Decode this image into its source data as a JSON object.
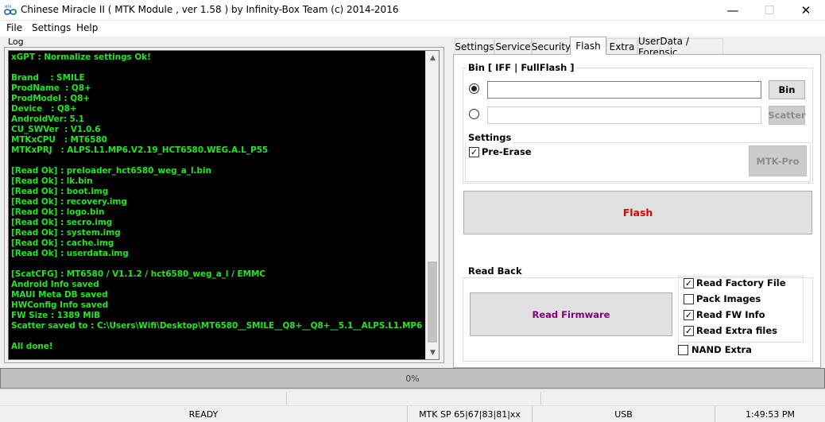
{
  "window": {
    "title": "Chinese Miracle II ( MTK Module , ver 1.58 ) by Infinity-Box Team (c) 2014-2016",
    "minimize_glyph": "—",
    "maximize_glyph": "☐",
    "close_glyph": "✕"
  },
  "menu": [
    "File",
    "Settings",
    "Help"
  ],
  "log": {
    "label": "Log",
    "lines": [
      "xGPT : Normalize settings Ok!",
      "",
      "Brand    : SMILE",
      "ProdName  : Q8+",
      "ProdModel : Q8+",
      "Device   : Q8+",
      "AndroidVer: 5.1",
      "CU_SWVer  : V1.0.6",
      "MTKxCPU   : MT6580",
      "MTKxPRJ   : ALPS.L1.MP6.V2.19_HCT6580.WEG.A.L_P55",
      "",
      "[Read Ok] : preloader_hct6580_weg_a_l.bin",
      "[Read Ok] : lk.bin",
      "[Read Ok] : boot.img",
      "[Read Ok] : recovery.img",
      "[Read Ok] : logo.bin",
      "[Read Ok] : secro.img",
      "[Read Ok] : system.img",
      "[Read Ok] : cache.img",
      "[Read Ok] : userdata.img",
      "",
      "[ScatCFG] : MT6580 / V1.1.2 / hct6580_weg_a_l / EMMC",
      "Android Info saved",
      "MAUI Meta DB saved",
      "HWConfig Info saved",
      "FW Size : 1389 MiB",
      "Scatter saved to : C:\\Users\\Wifi\\Desktop\\MT6580__SMILE__Q8+__Q8+__5.1__ALPS.L1.MP6",
      "",
      "All done!"
    ],
    "text_color": "#24e524"
  },
  "tabs": {
    "items": [
      "Settings",
      "Service",
      "Security",
      "Flash",
      "Extra",
      "UserData / Forensic"
    ],
    "active": "Flash"
  },
  "flash": {
    "bin_group_title": "Bin  [ IFF | FullFlash ]",
    "bin_path": "",
    "scatter_path": "",
    "bin_button": "Bin",
    "scatter_button": "Scatter",
    "settings_title": "Settings",
    "pre_erase_label": "Pre-Erase",
    "pre_erase_checked": true,
    "mtk_pro_button": "MTK-Pro",
    "flash_button": "Flash",
    "flash_button_color": "#e00000",
    "read_back_title": "Read Back",
    "read_firmware_button": "Read Firmware",
    "read_firmware_color": "#800080",
    "options": [
      {
        "label": "Read Factory File",
        "checked": true
      },
      {
        "label": "Pack Images",
        "checked": false
      },
      {
        "label": "Read FW Info",
        "checked": true
      },
      {
        "label": "Read Extra files",
        "checked": true
      }
    ],
    "nand_extra_label": "NAND Extra",
    "nand_extra_checked": false
  },
  "progress": {
    "value": 0,
    "text": "0%"
  },
  "status": {
    "state": "READY",
    "device": "MTK SP 65|67|83|81|xx",
    "port": "USB",
    "time": "1:49:53 PM"
  }
}
